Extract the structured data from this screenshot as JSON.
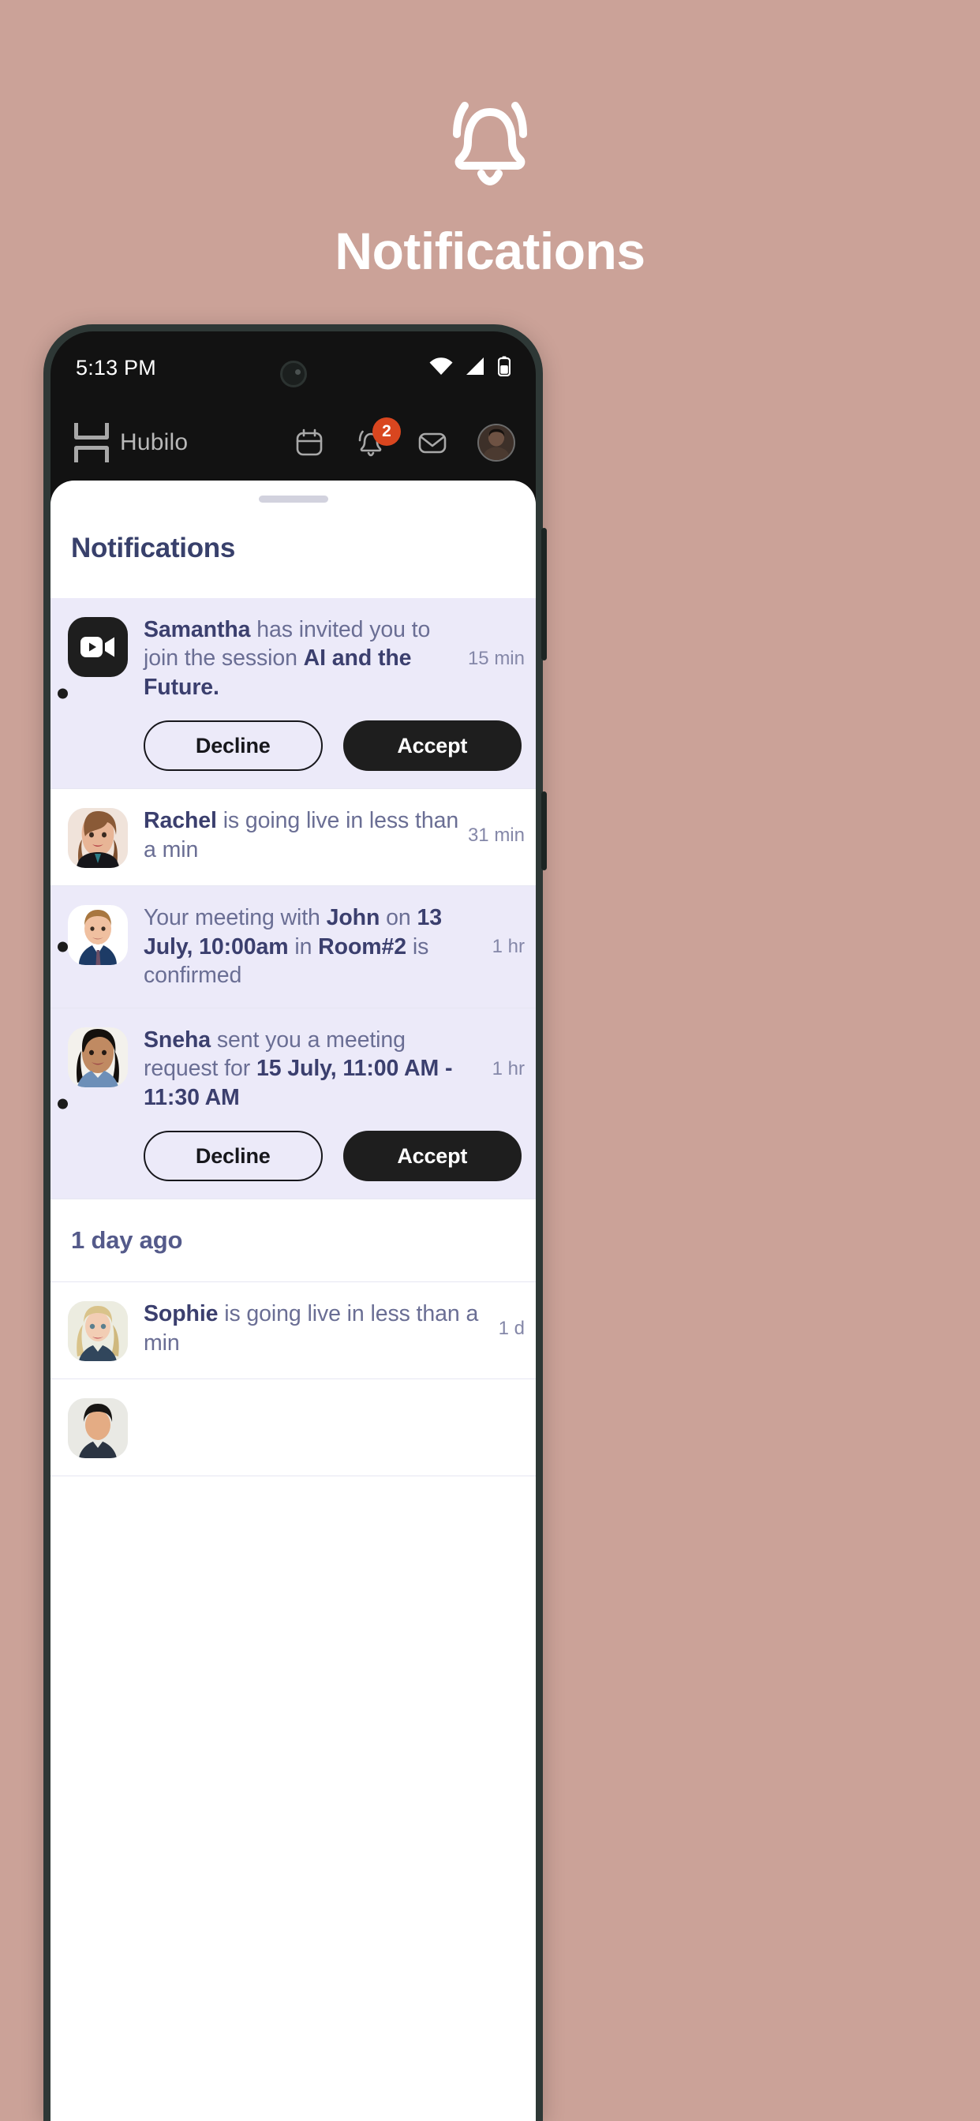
{
  "hero": {
    "icon": "bell-icon",
    "title": "Notifications",
    "background_color": "#cba298",
    "text_color": "#ffffff"
  },
  "phone": {
    "statusbar": {
      "time": "5:13 PM",
      "icons": [
        "wifi-icon",
        "cellular-signal-icon",
        "battery-icon"
      ]
    },
    "appheader": {
      "brand": "Hubilo",
      "logo_icon": "hubilo-logo-icon",
      "actions": [
        {
          "name": "calendar-icon",
          "badge": null
        },
        {
          "name": "bell-icon",
          "badge": "2"
        },
        {
          "name": "mail-icon",
          "badge": null
        },
        {
          "name": "profile-avatar",
          "badge": null
        }
      ],
      "badge_color": "#d9461f"
    }
  },
  "sheet": {
    "title": "Notifications",
    "title_color": "#38406b",
    "unread_bg": "#eceaf9",
    "sections": [
      {
        "heading": null,
        "items": [
          {
            "unread": true,
            "avatar_type": "video",
            "avatar_icon": "video-camera-icon",
            "parts": [
              {
                "text": "Samantha",
                "bold": true
              },
              {
                "text": " has invited you to join the session ",
                "bold": false
              },
              {
                "text": "AI and the Future.",
                "bold": true
              }
            ],
            "time": "15 min",
            "actions": {
              "decline": "Decline",
              "accept": "Accept"
            }
          },
          {
            "unread": false,
            "avatar_type": "photo",
            "avatar_icon": "avatar-rachel",
            "parts": [
              {
                "text": "Rachel",
                "bold": true
              },
              {
                "text": " is going live in less than a min",
                "bold": false
              }
            ],
            "time": "31 min",
            "actions": null
          },
          {
            "unread": true,
            "avatar_type": "photo",
            "avatar_icon": "avatar-john",
            "parts": [
              {
                "text": "Your meeting with ",
                "bold": false
              },
              {
                "text": "John",
                "bold": true
              },
              {
                "text": " on ",
                "bold": false
              },
              {
                "text": "13 July, 10:00am",
                "bold": true
              },
              {
                "text": " in  ",
                "bold": false
              },
              {
                "text": "Room#2",
                "bold": true
              },
              {
                "text": " is confirmed",
                "bold": false
              }
            ],
            "time": "1 hr",
            "actions": null
          },
          {
            "unread": true,
            "avatar_type": "photo",
            "avatar_icon": "avatar-sneha",
            "parts": [
              {
                "text": "Sneha",
                "bold": true
              },
              {
                "text": " sent you a meeting request for ",
                "bold": false
              },
              {
                "text": "15 July, 11:00 AM - 11:30 AM",
                "bold": true
              }
            ],
            "time": "1 hr",
            "actions": {
              "decline": "Decline",
              "accept": "Accept"
            }
          }
        ]
      },
      {
        "heading": "1 day ago",
        "items": [
          {
            "unread": false,
            "avatar_type": "photo",
            "avatar_icon": "avatar-sophie",
            "parts": [
              {
                "text": "Sophie",
                "bold": true
              },
              {
                "text": " is going live in less than a min",
                "bold": false
              }
            ],
            "time": "1 d",
            "actions": null
          },
          {
            "unread": false,
            "avatar_type": "photo",
            "avatar_icon": "avatar-partial",
            "parts": [],
            "time": "",
            "actions": null
          }
        ]
      }
    ]
  }
}
